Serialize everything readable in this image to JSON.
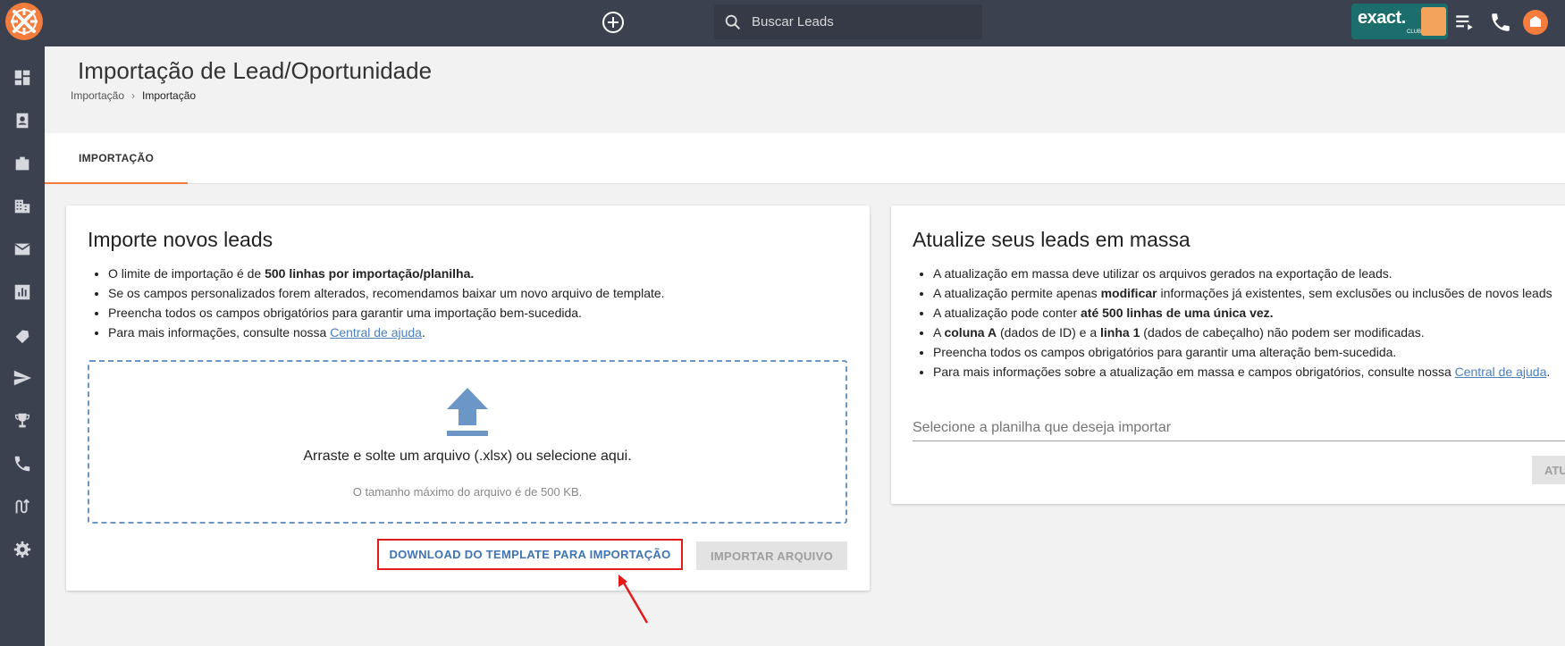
{
  "topbar": {
    "search_placeholder": "Buscar Leads",
    "brand_name": "exact.",
    "brand_sub": "CLUB"
  },
  "sidebar": {
    "icons": [
      "dashboard-icon",
      "contacts-icon",
      "briefcase-icon",
      "building-icon",
      "mail-icon",
      "reports-icon",
      "tags-icon",
      "send-icon",
      "trophy-icon",
      "phone-icon",
      "flow-icon",
      "settings-icon"
    ]
  },
  "header": {
    "title": "Importação de Lead/Oportunidade",
    "breadcrumb": [
      "Importação",
      "Importação"
    ]
  },
  "tabs": [
    {
      "label": "IMPORTAÇÃO",
      "active": true
    }
  ],
  "import_card": {
    "title": "Importe novos leads",
    "bullets": {
      "b1_pre": "O limite de importação é de ",
      "b1_bold": "500 linhas por importação/planilha.",
      "b2": "Se os campos personalizados forem alterados, recomendamos baixar um novo arquivo de template.",
      "b3": "Preencha todos os campos obrigatórios para garantir uma importação bem-sucedida.",
      "b4_pre": "Para mais informações, consulte nossa ",
      "b4_link": "Central de ajuda",
      "b4_post": "."
    },
    "dropzone_text": "Arraste e solte um arquivo (.xlsx) ou selecione aqui.",
    "dropzone_hint": "O tamanho máximo do arquivo é de 500 KB.",
    "download_button": "DOWNLOAD DO TEMPLATE PARA IMPORTAÇÃO",
    "import_button": "IMPORTAR ARQUIVO"
  },
  "update_card": {
    "title": "Atualize seus leads em massa",
    "bullets": {
      "b1": "A atualização em massa deve utilizar os arquivos gerados na exportação de leads.",
      "b2_pre": "A atualização permite apenas ",
      "b2_bold": "modificar",
      "b2_post": " informações já existentes, sem exclusões ou inclusões de novos leads",
      "b3_pre": "A atualização pode conter ",
      "b3_bold": "até 500 linhas de uma única vez.",
      "b4_a": "A ",
      "b4_b": "coluna A",
      "b4_c": " (dados de ID) e a ",
      "b4_d": "linha 1",
      "b4_e": " (dados de cabeçalho) não podem ser modificadas.",
      "b5": "Preencha todos os campos obrigatórios para garantir uma alteração bem-sucedida.",
      "b6_pre": "Para mais informações sobre a atualização em massa e campos obrigatórios, consulte nossa ",
      "b6_link": "Central de ajuda",
      "b6_post": "."
    },
    "select_placeholder": "Selecione a planilha que deseja importar",
    "update_button": "ATU"
  },
  "colors": {
    "topbar": "#3c4150",
    "accent": "#f47c3c",
    "link": "#4a7fc1",
    "highlight": "#e31b1b"
  }
}
